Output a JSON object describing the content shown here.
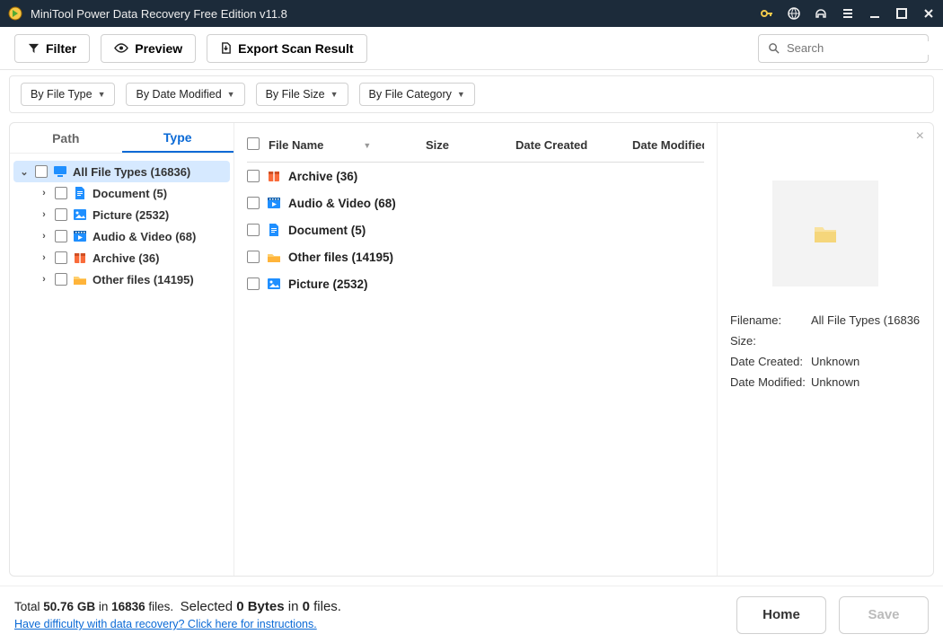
{
  "titlebar": {
    "title": "MiniTool Power Data Recovery Free Edition v11.8"
  },
  "toolbar": {
    "filter": "Filter",
    "preview": "Preview",
    "export": "Export Scan Result",
    "search_placeholder": "Search"
  },
  "filters": {
    "file_type": "By File Type",
    "date_modified": "By Date Modified",
    "file_size": "By File Size",
    "category": "By File Category"
  },
  "tabs": {
    "path": "Path",
    "type": "Type"
  },
  "tree": {
    "root": "All File Types (16836)",
    "children": [
      {
        "label": "Document (5)",
        "icon": "doc"
      },
      {
        "label": "Picture (2532)",
        "icon": "pic"
      },
      {
        "label": "Audio & Video (68)",
        "icon": "av"
      },
      {
        "label": "Archive (36)",
        "icon": "arc"
      },
      {
        "label": "Other files (14195)",
        "icon": "other"
      }
    ]
  },
  "columns": {
    "name": "File Name",
    "size": "Size",
    "created": "Date Created",
    "modified": "Date Modified"
  },
  "list": [
    {
      "label": "Archive (36)",
      "icon": "arc"
    },
    {
      "label": "Audio & Video (68)",
      "icon": "av"
    },
    {
      "label": "Document (5)",
      "icon": "doc"
    },
    {
      "label": "Other files (14195)",
      "icon": "other"
    },
    {
      "label": "Picture (2532)",
      "icon": "pic"
    }
  ],
  "details": {
    "filename_k": "Filename:",
    "filename_v": "All File Types (16836",
    "size_k": "Size:",
    "size_v": "",
    "dc_k": "Date Created:",
    "dc_v": "Unknown",
    "dm_k": "Date Modified:",
    "dm_v": "Unknown"
  },
  "footer": {
    "total_pre": "Total ",
    "total_size": "50.76 GB",
    "total_mid": " in ",
    "total_count": "16836",
    "total_post": " files.",
    "sel_pre": "Selected ",
    "sel_bytes": "0 Bytes",
    "sel_mid": " in ",
    "sel_count": "0",
    "sel_post": " files.",
    "help": "Have difficulty with data recovery? Click here for instructions.",
    "home": "Home",
    "save": "Save"
  },
  "icons": {
    "doc_color": "#1f8fff",
    "pic_color": "#1f8fff",
    "av_color": "#1f8fff",
    "arc_color": "#f96b3a",
    "other_color": "#ffb43a"
  }
}
